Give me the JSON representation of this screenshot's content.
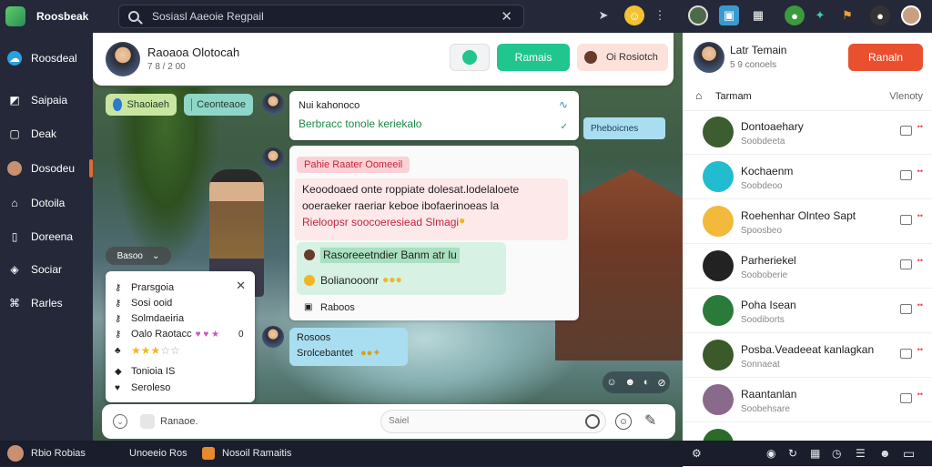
{
  "topbar": {
    "brand": "Roosbeak",
    "search_text": "Sosiasl Aaeoie Regpail",
    "search_close": "✕"
  },
  "sidebar": {
    "items": [
      {
        "label": "Roosdeal",
        "icon": "cloud-icon"
      },
      {
        "label": "Saipaia",
        "icon": "tag-icon"
      },
      {
        "label": "Deak",
        "icon": "square-icon"
      },
      {
        "label": "Dosodeu",
        "icon": "person-icon",
        "active": true
      },
      {
        "label": "Dotoila",
        "icon": "home-icon"
      },
      {
        "label": "Doreena",
        "icon": "phone-icon"
      },
      {
        "label": "Sociar",
        "icon": "shield-icon"
      },
      {
        "label": "Rarles",
        "icon": "building-icon"
      }
    ]
  },
  "chat_header": {
    "name": "Raoaoa Olotocah",
    "sub": "7 8 / 2 00",
    "call_button": "Ramais",
    "peach_button": "Oi Rosiotch"
  },
  "chips": [
    {
      "label": "Shaoiaeh"
    },
    {
      "label": "Ceonteaoe"
    }
  ],
  "messages": {
    "m1_title": "Nui kahonoco",
    "m1_text": "Berbracc tonole keriekalo",
    "side_tag": "Pheboicnes",
    "m2_tag": "Pahie Raater Oomeeil",
    "m2_line1": "Keoodoaed onte roppiate dolesat.lodelaloete",
    "m2_line2": "ooeraeker raeriar keboe ibofaerinoeas la",
    "m2_line3": "Rieloopsr soocoeresiead Slmagi",
    "reply1": "Rasoreeetndier Banm atr lu",
    "reply2": "Bolianooonr",
    "reply_footer": "Raboos",
    "m3_title": "Rosoos",
    "m3_text": "Srolcebantet"
  },
  "menu": {
    "pill": "Basoo",
    "items": [
      "Prarsgoia",
      "Sosi ooid",
      "Solmdaeiria",
      "Oalo Raotacc",
      "",
      "",
      "Tonioia IS",
      "Seroleso"
    ],
    "rating_value": "0",
    "rating_stars": 3
  },
  "composer": {
    "left_text": "Ranaoe.",
    "input_placeholder": "Saiel"
  },
  "right_panel": {
    "name": "Latr Temain",
    "sub": "5 9 conoels",
    "button": "Ranaln",
    "filter_label": "Tarmam",
    "filter_right": "Vlenoty",
    "conversations": [
      {
        "name": "Dontoaehary",
        "sub": "Soobdeeta",
        "avatar_color": "#3b5d2f"
      },
      {
        "name": "Kochaenm",
        "sub": "Soobdeoo",
        "avatar_color": "#22bcd0"
      },
      {
        "name": "Roehenhar Olnteo Sapt",
        "sub": "Spoosbeo",
        "avatar_color": "#f2b93b"
      },
      {
        "name": "Parheriekel",
        "sub": "Sooboberie",
        "avatar_color": "#222"
      },
      {
        "name": "Poha Isean",
        "sub": "Soodiborts",
        "avatar_color": "#2a7a3a"
      },
      {
        "name": "Posba.Veadeeat kanlagkan",
        "sub": "Sonnaeat",
        "avatar_color": "#3a5a2a"
      },
      {
        "name": "Raantanlan",
        "sub": "Soobehsare",
        "avatar_color": "#8a6a8a"
      },
      {
        "name": "",
        "sub": "",
        "avatar_color": "#2a6a2a"
      }
    ]
  },
  "bottombar": {
    "user": "Rbio Robias",
    "dropdown": "Unoeeio Ros",
    "notice": "Nosoil Ramaitis"
  },
  "colors": {
    "accent_green": "#21c58e",
    "accent_red": "#e8502f",
    "sidebar_bg": "#242839"
  }
}
